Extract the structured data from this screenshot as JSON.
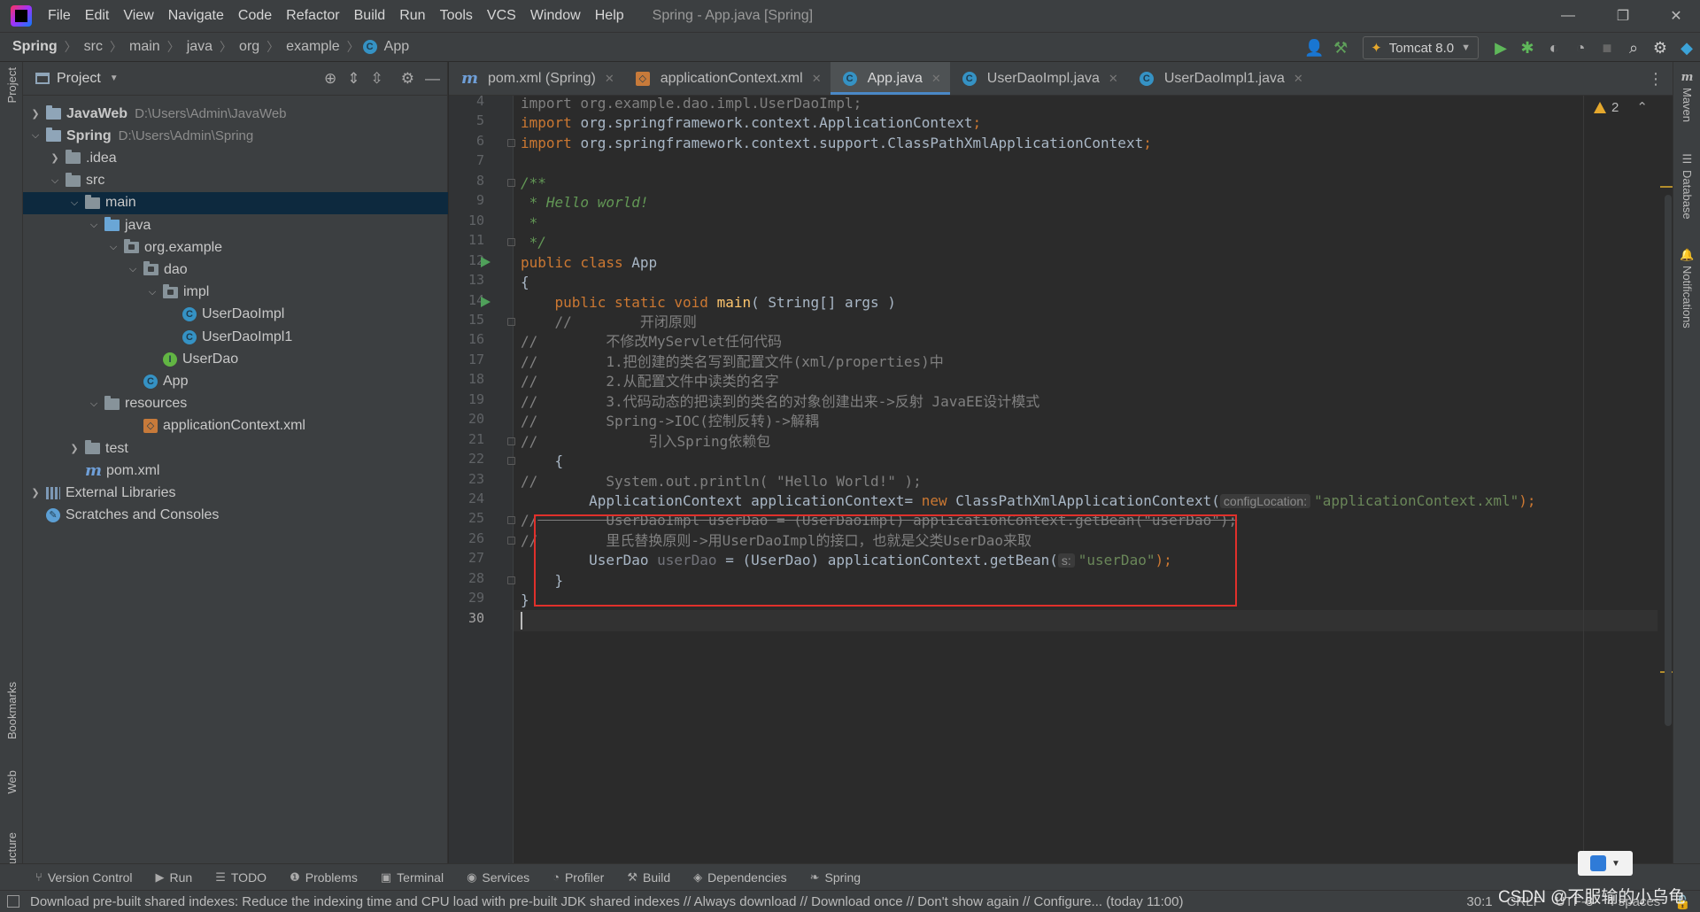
{
  "menubar": {
    "items": [
      "File",
      "Edit",
      "View",
      "Navigate",
      "Code",
      "Refactor",
      "Build",
      "Run",
      "Tools",
      "VCS",
      "Window",
      "Help"
    ],
    "window_title": "Spring - App.java [Spring]"
  },
  "navbar": {
    "breadcrumbs": [
      "Spring",
      "src",
      "main",
      "java",
      "org",
      "example",
      "App"
    ],
    "run_config": "Tomcat 8.0"
  },
  "left_strip": {
    "tabs": [
      "Project",
      "Bookmarks",
      "Web",
      "Structure"
    ]
  },
  "right_strip": {
    "tabs": [
      "Maven",
      "Database",
      "Notifications"
    ]
  },
  "project_panel": {
    "title": "Project",
    "tree": [
      {
        "label": "JavaWeb",
        "path": "D:\\Users\\Admin\\JavaWeb",
        "level": 0,
        "arrow": "›",
        "icon": "module",
        "bold": true
      },
      {
        "label": "Spring",
        "path": "D:\\Users\\Admin\\Spring",
        "level": 0,
        "arrow": "⌄",
        "icon": "module",
        "bold": true
      },
      {
        "label": ".idea",
        "path": "",
        "level": 1,
        "arrow": "›",
        "icon": "folder"
      },
      {
        "label": "src",
        "path": "",
        "level": 1,
        "arrow": "⌄",
        "icon": "folder"
      },
      {
        "label": "main",
        "path": "",
        "level": 2,
        "arrow": "⌄",
        "icon": "folder",
        "selected": true
      },
      {
        "label": "java",
        "path": "",
        "level": 3,
        "arrow": "⌄",
        "icon": "folder-blue"
      },
      {
        "label": "org.example",
        "path": "",
        "level": 4,
        "arrow": "⌄",
        "icon": "package"
      },
      {
        "label": "dao",
        "path": "",
        "level": 5,
        "arrow": "⌄",
        "icon": "package"
      },
      {
        "label": "impl",
        "path": "",
        "level": 6,
        "arrow": "⌄",
        "icon": "package"
      },
      {
        "label": "UserDaoImpl",
        "path": "",
        "level": 7,
        "arrow": "",
        "icon": "class"
      },
      {
        "label": "UserDaoImpl1",
        "path": "",
        "level": 7,
        "arrow": "",
        "icon": "class"
      },
      {
        "label": "UserDao",
        "path": "",
        "level": 6,
        "arrow": "",
        "icon": "interface"
      },
      {
        "label": "App",
        "path": "",
        "level": 5,
        "arrow": "",
        "icon": "class"
      },
      {
        "label": "resources",
        "path": "",
        "level": 3,
        "arrow": "⌄",
        "icon": "folder"
      },
      {
        "label": "applicationContext.xml",
        "path": "",
        "level": 5,
        "arrow": "",
        "icon": "xml"
      },
      {
        "label": "test",
        "path": "",
        "level": 2,
        "arrow": "›",
        "icon": "folder"
      },
      {
        "label": "pom.xml",
        "path": "",
        "level": 2,
        "arrow": "",
        "icon": "maven"
      },
      {
        "label": "External Libraries",
        "path": "",
        "level": 0,
        "arrow": "›",
        "icon": "library"
      },
      {
        "label": "Scratches and Consoles",
        "path": "",
        "level": 0,
        "arrow": "",
        "icon": "scratch"
      }
    ]
  },
  "editor_tabs": [
    {
      "label": "pom.xml (Spring)",
      "icon": "maven",
      "active": false
    },
    {
      "label": "applicationContext.xml",
      "icon": "xml",
      "active": false
    },
    {
      "label": "App.java",
      "icon": "class",
      "active": true
    },
    {
      "label": "UserDaoImpl.java",
      "icon": "class",
      "active": false
    },
    {
      "label": "UserDaoImpl1.java",
      "icon": "class",
      "active": false
    }
  ],
  "inspections": {
    "warning_count": "2"
  },
  "editor": {
    "line_numbers": [
      "4",
      "5",
      "6",
      "7",
      "8",
      "9",
      "10",
      "11",
      "12",
      "13",
      "14",
      "15",
      "16",
      "17",
      "18",
      "19",
      "20",
      "21",
      "22",
      "23",
      "24",
      "25",
      "26",
      "27",
      "28",
      "29",
      "30"
    ],
    "run_marker_lines": [
      "12",
      "14"
    ],
    "lines": [
      [
        {
          "t": "import org.example.dao.impl.UserDaoImpl;",
          "c": "cm"
        }
      ],
      [
        {
          "t": "import ",
          "c": "kw"
        },
        {
          "t": "org.springframework.context.ApplicationContext",
          "c": ""
        },
        {
          "t": ";",
          "c": "kw"
        }
      ],
      [
        {
          "t": "import ",
          "c": "kw"
        },
        {
          "t": "org.springframework.context.support.ClassPathXmlApplicationContext",
          "c": ""
        },
        {
          "t": ";",
          "c": "kw"
        }
      ],
      [],
      [
        {
          "t": "/**",
          "c": "doc"
        }
      ],
      [
        {
          "t": " * Hello world!",
          "c": "doc"
        }
      ],
      [
        {
          "t": " *",
          "c": "doc"
        }
      ],
      [
        {
          "t": " */",
          "c": "doc"
        }
      ],
      [
        {
          "t": "public class ",
          "c": "kw"
        },
        {
          "t": "App",
          "c": ""
        }
      ],
      [
        {
          "t": "{",
          "c": ""
        }
      ],
      [
        {
          "t": "    public static void ",
          "c": "kw"
        },
        {
          "t": "main",
          "c": "fn"
        },
        {
          "t": "( String[] args )",
          "c": ""
        }
      ],
      [
        {
          "t": "    //        开闭原则",
          "c": "cm"
        }
      ],
      [
        {
          "t": "//        不修改MyServlet任何代码",
          "c": "cm"
        }
      ],
      [
        {
          "t": "//        1.把创建的类名写到配置文件(xml/properties)中",
          "c": "cm"
        }
      ],
      [
        {
          "t": "//        2.从配置文件中读类的名字",
          "c": "cm"
        }
      ],
      [
        {
          "t": "//        3.代码动态的把读到的类名的对象创建出来->反射 JavaEE设计模式",
          "c": "cm"
        }
      ],
      [
        {
          "t": "//        Spring->IOC(控制反转)->解耦",
          "c": "cm"
        }
      ],
      [
        {
          "t": "//             引入Spring依赖包",
          "c": "cm"
        }
      ],
      [
        {
          "t": "    {",
          "c": ""
        }
      ],
      [
        {
          "t": "//        System.out.println( \"Hello World!\" );",
          "c": "cm"
        }
      ],
      [
        {
          "t": "        ApplicationContext applicationContext= ",
          "c": ""
        },
        {
          "t": "new ",
          "c": "kw"
        },
        {
          "t": "ClassPathXmlApplicationContext(",
          "c": ""
        },
        {
          "t": "configLocation:",
          "c": "hint"
        },
        {
          "t": "\"applicationContext.xml\"",
          "c": "str"
        },
        {
          "t": ");",
          "c": "kw"
        }
      ],
      [
        {
          "t": "//",
          "c": "cm"
        },
        {
          "t": "        UserDaoImpl userDao = (UserDaoImpl) applicationContext.getBean(\"userDao\");",
          "c": "strike"
        }
      ],
      [
        {
          "t": "//        里氏替换原则->用UserDaoImpl的接口，也就是父类UserDao来取",
          "c": "cm"
        }
      ],
      [
        {
          "t": "        UserDao ",
          "c": ""
        },
        {
          "t": "userDao",
          "c": "var-unused"
        },
        {
          "t": " = (UserDao) applicationContext.getBean(",
          "c": ""
        },
        {
          "t": "s:",
          "c": "hint"
        },
        {
          "t": "\"userDao\"",
          "c": "str"
        },
        {
          "t": ");",
          "c": "kw"
        }
      ],
      [
        {
          "t": "    }",
          "c": ""
        }
      ],
      [
        {
          "t": "}",
          "c": ""
        }
      ],
      []
    ]
  },
  "bottom_tools": [
    {
      "label": "Version Control",
      "icon": "⑂"
    },
    {
      "label": "Run",
      "icon": "▶"
    },
    {
      "label": "TODO",
      "icon": "☰"
    },
    {
      "label": "Problems",
      "icon": "❶"
    },
    {
      "label": "Terminal",
      "icon": "▣"
    },
    {
      "label": "Services",
      "icon": "◉"
    },
    {
      "label": "Profiler",
      "icon": "◔"
    },
    {
      "label": "Build",
      "icon": "⚒"
    },
    {
      "label": "Dependencies",
      "icon": "◈"
    },
    {
      "label": "Spring",
      "icon": "❧"
    }
  ],
  "statusbar": {
    "message": "Download pre-built shared indexes: Reduce the indexing time and CPU load with pre-built JDK shared indexes // Always download // Download once // Don't show again // Configure... (today 11:00)",
    "position": "30:1",
    "line_sep": "CRLF",
    "encoding": "UTF-8",
    "indent": "4 spaces"
  },
  "watermark": "CSDN @不服输的小乌龟"
}
